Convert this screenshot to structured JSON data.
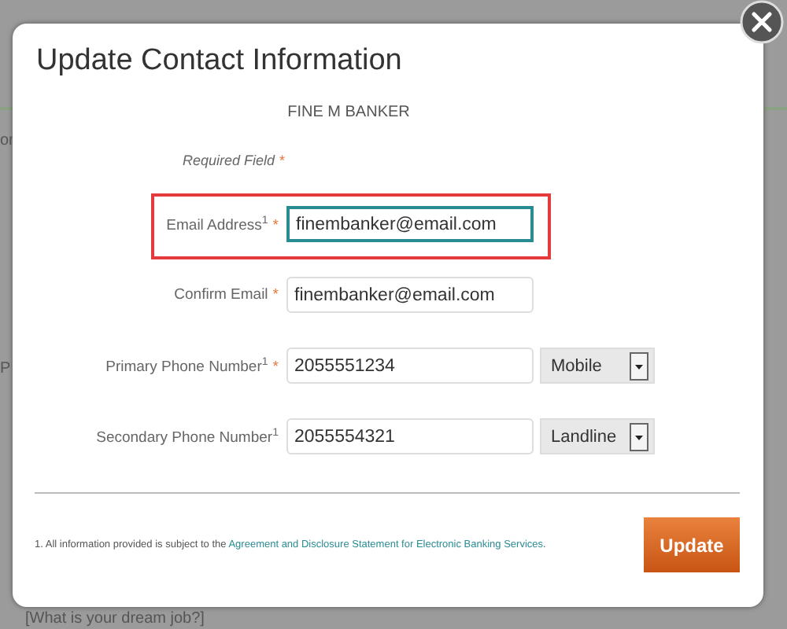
{
  "background": {
    "texts": [
      {
        "kind": "small",
        "text": "or"
      },
      {
        "kind": "small",
        "text": "P"
      },
      {
        "kind": "bottom",
        "text": "[What is your dream job?]"
      }
    ]
  },
  "dialog": {
    "title": "Update Contact Information",
    "name": "FINE M BANKER",
    "required_note": {
      "label": "Required Field",
      "mark": "*"
    },
    "fields": [
      {
        "label": "Email Address$^{1}$",
        "required_mark": "*",
        "value": "finembanker@email.com",
        "focused": true,
        "highlighted": true
      },
      {
        "label": "Confirm Email",
        "required_mark": "*",
        "value": "finembanker@email.com",
        "focused": false,
        "highlighted": false
      },
      {
        "label": "Primary Phone Number$^{1}$",
        "required_mark": "*",
        "value": "2055551234",
        "focused": false,
        "highlighted": false,
        "select": "Mobile"
      },
      {
        "label": "Secondary Phone Number$^{1}$",
        "value": "2055554321",
        "focused": false,
        "highlighted": false,
        "select": "Landline"
      }
    ],
    "footnote": {
      "text": "1. All information provided is subject to the ",
      "link": "Agreement and Disclosure Statement for Electronic Banking Services",
      "end": "."
    },
    "button": "Update"
  }
}
